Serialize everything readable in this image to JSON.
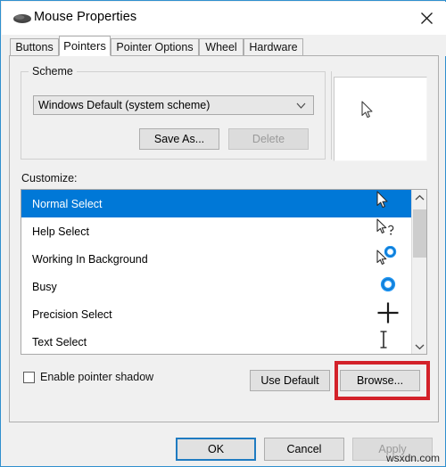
{
  "window": {
    "title": "Mouse Properties",
    "icon": "mouse-icon",
    "close_icon": "close-icon",
    "border_color": "#2f8fce"
  },
  "tabs": [
    {
      "label": "Buttons",
      "active": false
    },
    {
      "label": "Pointers",
      "active": true
    },
    {
      "label": "Pointer Options",
      "active": false
    },
    {
      "label": "Wheel",
      "active": false
    },
    {
      "label": "Hardware",
      "active": false
    }
  ],
  "scheme": {
    "group_label": "Scheme",
    "combo_value": "Windows Default (system scheme)",
    "combo_arrow_icon": "chevron-down-icon",
    "save_as_label": "Save As...",
    "delete_label": "Delete",
    "delete_disabled": true
  },
  "preview": {
    "cursor_icon": "arrow-cursor-icon"
  },
  "customize": {
    "label": "Customize:",
    "selection_color": "#0078d7",
    "rows": [
      {
        "label": "Normal Select",
        "cursor_icon": "arrow-cursor-icon",
        "selected": true
      },
      {
        "label": "Help Select",
        "cursor_icon": "arrow-question-cursor-icon",
        "selected": false
      },
      {
        "label": "Working In Background",
        "cursor_icon": "arrow-ring-cursor-icon",
        "selected": false
      },
      {
        "label": "Busy",
        "cursor_icon": "ring-cursor-icon",
        "selected": false
      },
      {
        "label": "Precision Select",
        "cursor_icon": "crosshair-cursor-icon",
        "selected": false
      },
      {
        "label": "Text Select",
        "cursor_icon": "ibeam-cursor-icon",
        "selected": false
      }
    ],
    "scrollbar": {
      "up_icon": "chevron-up-icon",
      "down_icon": "chevron-down-icon"
    }
  },
  "options": {
    "pointer_shadow_label": "Enable pointer shadow",
    "pointer_shadow_checked": false,
    "use_default_label": "Use Default",
    "browse_label": "Browse...",
    "highlight_color": "#d3222a"
  },
  "dialog_buttons": {
    "ok_label": "OK",
    "cancel_label": "Cancel",
    "apply_label": "Apply",
    "apply_disabled": true
  },
  "watermark": {
    "text": "wsxdn.com"
  }
}
